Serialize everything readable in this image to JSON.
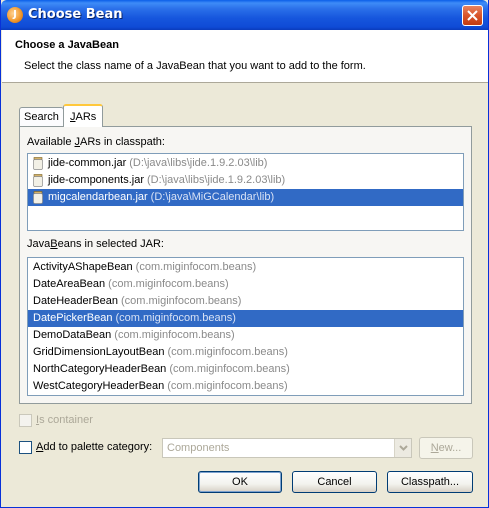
{
  "window": {
    "title": "Choose Bean",
    "app_icon_glyph": "J"
  },
  "header": {
    "title": "Choose a JavaBean",
    "description": "Select the class name of a JavaBean that you want to add to the form."
  },
  "tabs": [
    {
      "label": "Search",
      "selected": false
    },
    {
      "label": "JARs",
      "mnemonic": "J",
      "rest": "ARs",
      "selected": true
    }
  ],
  "jars_panel": {
    "available_label_pre": "Available ",
    "available_label_mnemonic": "J",
    "available_label_post": "ARs in classpath:",
    "jars": [
      {
        "name": "jide-common.jar",
        "path": "(D:\\java\\libs\\jide.1.9.2.03\\lib)",
        "selected": false
      },
      {
        "name": "jide-components.jar",
        "path": "(D:\\java\\libs\\jide.1.9.2.03\\lib)",
        "selected": false
      },
      {
        "name": "migcalendarbean.jar",
        "path": "(D:\\java\\MiGCalendar\\lib)",
        "selected": true
      }
    ],
    "beans_label_pre": "Java",
    "beans_label_mnemonic": "B",
    "beans_label_post": "eans in selected JAR:",
    "beans": [
      {
        "name": "ActivityAShapeBean",
        "pkg": "(com.miginfocom.beans)",
        "selected": false
      },
      {
        "name": "DateAreaBean",
        "pkg": "(com.miginfocom.beans)",
        "selected": false
      },
      {
        "name": "DateHeaderBean",
        "pkg": "(com.miginfocom.beans)",
        "selected": false
      },
      {
        "name": "DatePickerBean",
        "pkg": "(com.miginfocom.beans)",
        "selected": true
      },
      {
        "name": "DemoDataBean",
        "pkg": "(com.miginfocom.beans)",
        "selected": false
      },
      {
        "name": "GridDimensionLayoutBean",
        "pkg": "(com.miginfocom.beans)",
        "selected": false
      },
      {
        "name": "NorthCategoryHeaderBean",
        "pkg": "(com.miginfocom.beans)",
        "selected": false
      },
      {
        "name": "WestCategoryHeaderBean",
        "pkg": "(com.miginfocom.beans)",
        "selected": false
      }
    ]
  },
  "is_container": {
    "label_mnemonic": "I",
    "label_rest": "s container",
    "checked": false,
    "enabled": false
  },
  "palette": {
    "label_mnemonic": "A",
    "label_rest": "dd to palette category:",
    "checked": false,
    "category_value": "Components",
    "new_button_mnemonic": "N",
    "new_button_rest": "ew..."
  },
  "buttons": {
    "ok": "OK",
    "cancel": "Cancel",
    "classpath": "Classpath..."
  },
  "colors": {
    "title_bar": "#0f4bd6",
    "selection": "#316ac5",
    "dialog_bg": "#ece9d8"
  }
}
